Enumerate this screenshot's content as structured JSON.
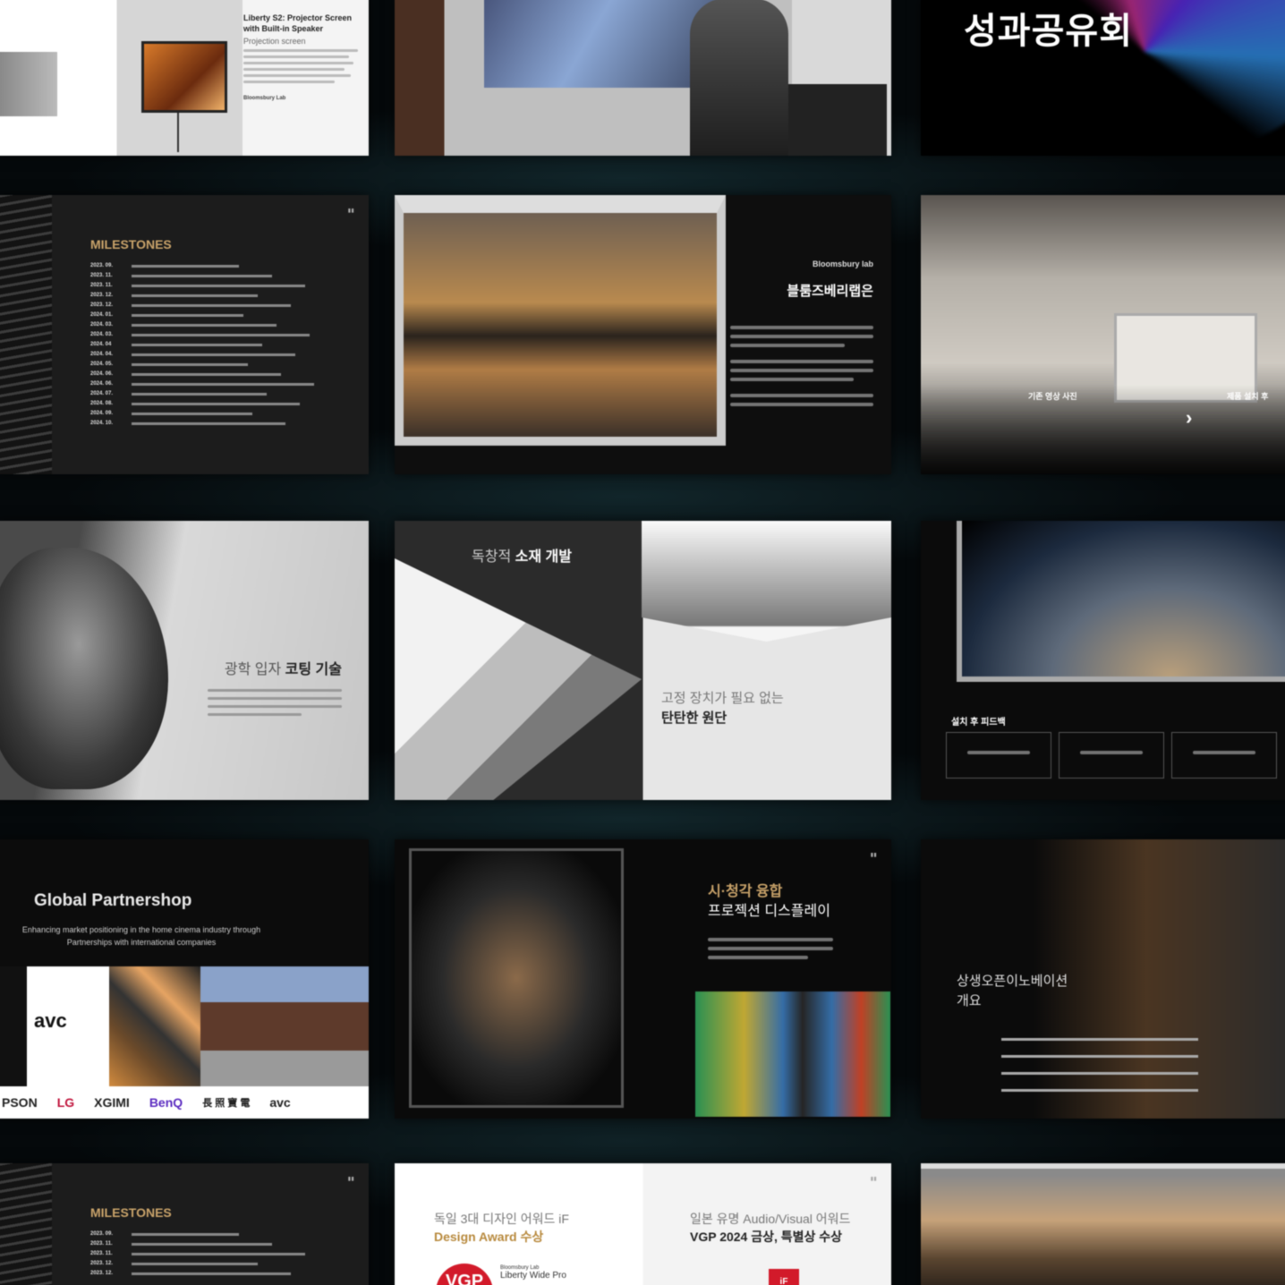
{
  "slides": {
    "projector": {
      "tags": [
        "",
        ""
      ],
      "title": "Liberty S2: Projector Screen with Built-in Speaker",
      "subtitle": "Projection screen",
      "footer": "Bloomsbury Lab"
    },
    "title_slide": {
      "heading": "성과공유회"
    },
    "milestones": {
      "heading": "MILESTONES",
      "rows": [
        {
          "date": "2023. 09."
        },
        {
          "date": "2023. 11."
        },
        {
          "date": "2023. 11."
        },
        {
          "date": "2023. 12."
        },
        {
          "date": "2023. 12."
        },
        {
          "date": "2024. 01."
        },
        {
          "date": "2024. 03."
        },
        {
          "date": "2024. 03."
        },
        {
          "date": "2024. 04"
        },
        {
          "date": "2024. 04."
        },
        {
          "date": "2024. 05."
        },
        {
          "date": "2024. 06."
        },
        {
          "date": "2024. 06."
        },
        {
          "date": "2024. 07."
        },
        {
          "date": "2024. 08."
        },
        {
          "date": "2024. 09."
        },
        {
          "date": "2024. 10."
        }
      ]
    },
    "lake": {
      "logo": "Bloomsbury lab",
      "heading": "블룸즈베리랩은"
    },
    "theater": {
      "left_label": "기존 영상 사진",
      "right_label": "제품 설치 후"
    },
    "coating": {
      "heading_light": "광학 입자",
      "heading_bold": "코팅 기술"
    },
    "material": {
      "heading_light": "독창적",
      "heading_bold": "소재 개발",
      "heading2_light": "고정 장치가 필요 없는",
      "heading2_bold": "탄탄한 원단"
    },
    "earth": {
      "heading": "설치 후 피드백",
      "boxes": [
        "",
        "",
        ""
      ]
    },
    "global": {
      "heading": "Global Partnershop",
      "sub1": "Enhancing market positioning in the home cinema industry through",
      "sub2": "Partnerships with international companies",
      "avc_logo": "avc",
      "brands": [
        "PSON",
        "LG",
        "XGIMI",
        "BenQ",
        "長 照 寶 電",
        "avc"
      ]
    },
    "fusion": {
      "heading1": "시·청각 융합",
      "heading2": "프로젝션 디스플레이"
    },
    "innovation": {
      "heading1": "상생오픈이노베이션",
      "heading2": "개요",
      "keys": [
        "",
        "",
        "",
        ""
      ]
    },
    "milestones2": {
      "heading": "MILESTONES",
      "rows": [
        {
          "date": "2023. 09."
        },
        {
          "date": "2023. 11."
        },
        {
          "date": "2023. 11."
        },
        {
          "date": "2023. 12."
        },
        {
          "date": "2023. 12."
        }
      ]
    },
    "awards": {
      "left_light": "독일 3대 디자인 어워드 iF",
      "left_bold": "Design Award 수상",
      "right_light": "일본 유명 Audio/Visual 어워드",
      "right_bold": "VGP 2024 금상, 특별상 수상",
      "vgp_badge": "VGP",
      "product_brand": "Bloomsbury Lab",
      "product_name": "Liberty Wide Pro",
      "if_badge": "iF"
    }
  }
}
